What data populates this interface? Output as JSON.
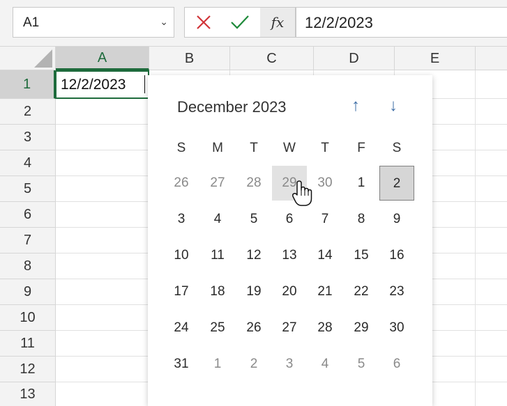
{
  "namebox": {
    "value": "A1"
  },
  "formula_bar": {
    "cancel_icon": "x-icon",
    "enter_icon": "checkmark-icon",
    "fx_label": "fx",
    "value": "12/2/2023"
  },
  "columns": [
    "A",
    "B",
    "C",
    "D",
    "E"
  ],
  "rows": [
    "1",
    "2",
    "3",
    "4",
    "5",
    "6",
    "7",
    "8",
    "9",
    "10",
    "11",
    "12",
    "13"
  ],
  "active_cell": {
    "value": "12/2/2023"
  },
  "calendar": {
    "title": "December 2023",
    "nav": {
      "up_icon": "arrow-up-icon",
      "down_icon": "arrow-down-icon"
    },
    "weekdays": [
      "S",
      "M",
      "T",
      "W",
      "T",
      "F",
      "S"
    ],
    "weeks": [
      [
        "26",
        "27",
        "28",
        "29",
        "30",
        "1",
        "2"
      ],
      [
        "3",
        "4",
        "5",
        "6",
        "7",
        "8",
        "9"
      ],
      [
        "10",
        "11",
        "12",
        "13",
        "14",
        "15",
        "16"
      ],
      [
        "17",
        "18",
        "19",
        "20",
        "21",
        "22",
        "23"
      ],
      [
        "24",
        "25",
        "26",
        "27",
        "28",
        "29",
        "30"
      ],
      [
        "31",
        "1",
        "2",
        "3",
        "4",
        "5",
        "6"
      ]
    ],
    "selected_day": "2",
    "hovered_day": "29"
  },
  "colors": {
    "accent": "#1e6b3c",
    "arrow": "#3e6ea6",
    "cancel": "#d13438",
    "enter": "#1e8a3a"
  }
}
